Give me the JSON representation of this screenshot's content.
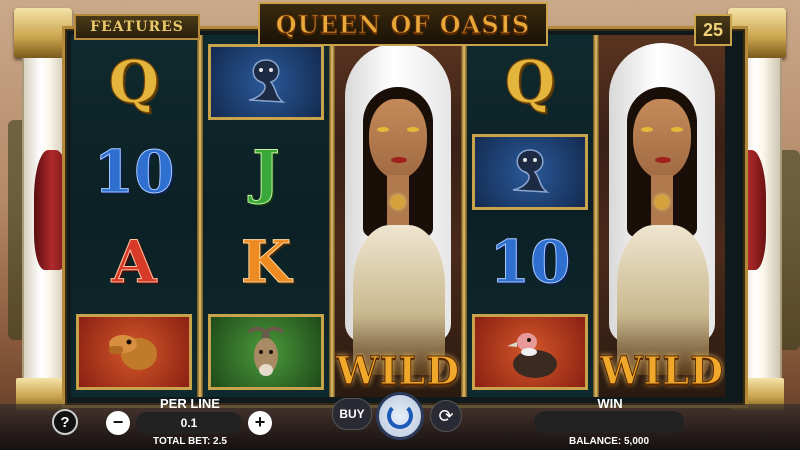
{
  "header": {
    "features_label": "FEATURES",
    "title": "QUEEN OF OASIS",
    "lines_count": "25"
  },
  "reels": [
    [
      "Q",
      "10",
      "A",
      "camel"
    ],
    [
      "cobra",
      "J",
      "K",
      "ibex"
    ],
    [
      "queen-wild"
    ],
    [
      "Q",
      "cobra",
      "10",
      "vulture"
    ],
    [
      "queen-wild"
    ]
  ],
  "wild_label": "WILD",
  "controls": {
    "help_label": "?",
    "per_line_label": "PER LINE",
    "minus_label": "−",
    "per_line_value": "0.1",
    "plus_label": "+",
    "total_bet": "TOTAL BET: 2.5",
    "buy_label": "BUY",
    "auto_icon": "⟳",
    "win_label": "WIN",
    "win_value": "",
    "balance": "BALANCE: 5,000"
  },
  "colors": {
    "gold": "#c9a24c",
    "spin_accent": "#1e5ab8"
  }
}
